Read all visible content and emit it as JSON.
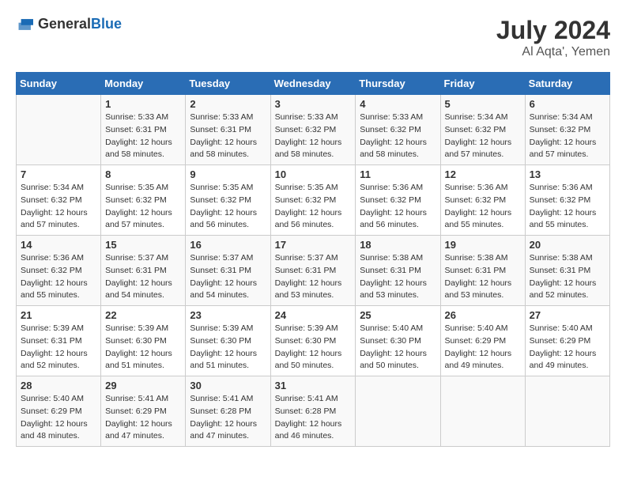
{
  "header": {
    "logo_general": "General",
    "logo_blue": "Blue",
    "month_year": "July 2024",
    "location": "Al Aqta', Yemen"
  },
  "columns": [
    "Sunday",
    "Monday",
    "Tuesday",
    "Wednesday",
    "Thursday",
    "Friday",
    "Saturday"
  ],
  "weeks": [
    [
      {
        "day": "",
        "info": ""
      },
      {
        "day": "1",
        "info": "Sunrise: 5:33 AM\nSunset: 6:31 PM\nDaylight: 12 hours and 58 minutes."
      },
      {
        "day": "2",
        "info": "Sunrise: 5:33 AM\nSunset: 6:31 PM\nDaylight: 12 hours and 58 minutes."
      },
      {
        "day": "3",
        "info": "Sunrise: 5:33 AM\nSunset: 6:32 PM\nDaylight: 12 hours and 58 minutes."
      },
      {
        "day": "4",
        "info": "Sunrise: 5:33 AM\nSunset: 6:32 PM\nDaylight: 12 hours and 58 minutes."
      },
      {
        "day": "5",
        "info": "Sunrise: 5:34 AM\nSunset: 6:32 PM\nDaylight: 12 hours and 57 minutes."
      },
      {
        "day": "6",
        "info": "Sunrise: 5:34 AM\nSunset: 6:32 PM\nDaylight: 12 hours and 57 minutes."
      }
    ],
    [
      {
        "day": "7",
        "info": "Sunrise: 5:34 AM\nSunset: 6:32 PM\nDaylight: 12 hours and 57 minutes."
      },
      {
        "day": "8",
        "info": "Sunrise: 5:35 AM\nSunset: 6:32 PM\nDaylight: 12 hours and 57 minutes."
      },
      {
        "day": "9",
        "info": "Sunrise: 5:35 AM\nSunset: 6:32 PM\nDaylight: 12 hours and 56 minutes."
      },
      {
        "day": "10",
        "info": "Sunrise: 5:35 AM\nSunset: 6:32 PM\nDaylight: 12 hours and 56 minutes."
      },
      {
        "day": "11",
        "info": "Sunrise: 5:36 AM\nSunset: 6:32 PM\nDaylight: 12 hours and 56 minutes."
      },
      {
        "day": "12",
        "info": "Sunrise: 5:36 AM\nSunset: 6:32 PM\nDaylight: 12 hours and 55 minutes."
      },
      {
        "day": "13",
        "info": "Sunrise: 5:36 AM\nSunset: 6:32 PM\nDaylight: 12 hours and 55 minutes."
      }
    ],
    [
      {
        "day": "14",
        "info": "Sunrise: 5:36 AM\nSunset: 6:32 PM\nDaylight: 12 hours and 55 minutes."
      },
      {
        "day": "15",
        "info": "Sunrise: 5:37 AM\nSunset: 6:31 PM\nDaylight: 12 hours and 54 minutes."
      },
      {
        "day": "16",
        "info": "Sunrise: 5:37 AM\nSunset: 6:31 PM\nDaylight: 12 hours and 54 minutes."
      },
      {
        "day": "17",
        "info": "Sunrise: 5:37 AM\nSunset: 6:31 PM\nDaylight: 12 hours and 53 minutes."
      },
      {
        "day": "18",
        "info": "Sunrise: 5:38 AM\nSunset: 6:31 PM\nDaylight: 12 hours and 53 minutes."
      },
      {
        "day": "19",
        "info": "Sunrise: 5:38 AM\nSunset: 6:31 PM\nDaylight: 12 hours and 53 minutes."
      },
      {
        "day": "20",
        "info": "Sunrise: 5:38 AM\nSunset: 6:31 PM\nDaylight: 12 hours and 52 minutes."
      }
    ],
    [
      {
        "day": "21",
        "info": "Sunrise: 5:39 AM\nSunset: 6:31 PM\nDaylight: 12 hours and 52 minutes."
      },
      {
        "day": "22",
        "info": "Sunrise: 5:39 AM\nSunset: 6:30 PM\nDaylight: 12 hours and 51 minutes."
      },
      {
        "day": "23",
        "info": "Sunrise: 5:39 AM\nSunset: 6:30 PM\nDaylight: 12 hours and 51 minutes."
      },
      {
        "day": "24",
        "info": "Sunrise: 5:39 AM\nSunset: 6:30 PM\nDaylight: 12 hours and 50 minutes."
      },
      {
        "day": "25",
        "info": "Sunrise: 5:40 AM\nSunset: 6:30 PM\nDaylight: 12 hours and 50 minutes."
      },
      {
        "day": "26",
        "info": "Sunrise: 5:40 AM\nSunset: 6:29 PM\nDaylight: 12 hours and 49 minutes."
      },
      {
        "day": "27",
        "info": "Sunrise: 5:40 AM\nSunset: 6:29 PM\nDaylight: 12 hours and 49 minutes."
      }
    ],
    [
      {
        "day": "28",
        "info": "Sunrise: 5:40 AM\nSunset: 6:29 PM\nDaylight: 12 hours and 48 minutes."
      },
      {
        "day": "29",
        "info": "Sunrise: 5:41 AM\nSunset: 6:29 PM\nDaylight: 12 hours and 47 minutes."
      },
      {
        "day": "30",
        "info": "Sunrise: 5:41 AM\nSunset: 6:28 PM\nDaylight: 12 hours and 47 minutes."
      },
      {
        "day": "31",
        "info": "Sunrise: 5:41 AM\nSunset: 6:28 PM\nDaylight: 12 hours and 46 minutes."
      },
      {
        "day": "",
        "info": ""
      },
      {
        "day": "",
        "info": ""
      },
      {
        "day": "",
        "info": ""
      }
    ]
  ]
}
